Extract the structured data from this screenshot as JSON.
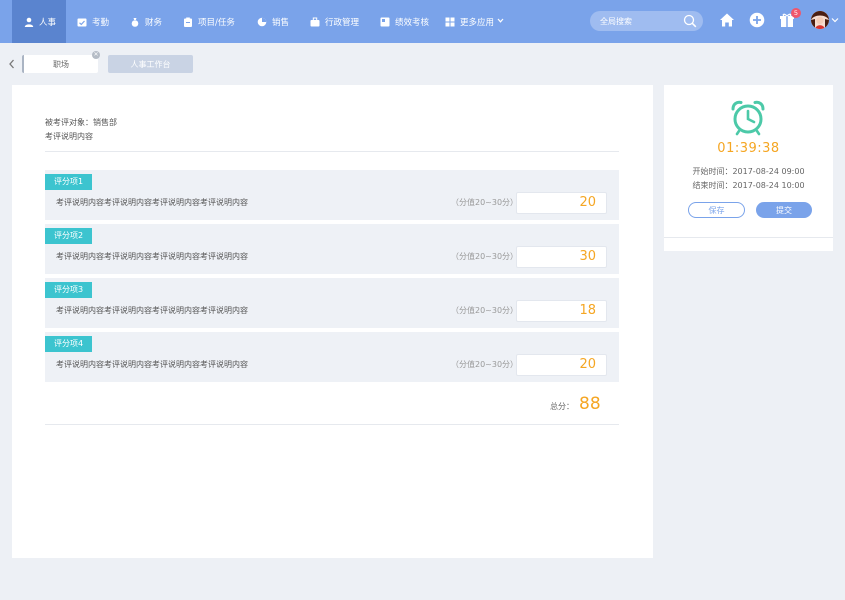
{
  "nav": {
    "items": [
      {
        "label": "人事",
        "icon": "person-icon"
      },
      {
        "label": "考勤",
        "icon": "calendar-check-icon"
      },
      {
        "label": "财务",
        "icon": "money-bag-icon"
      },
      {
        "label": "项目/任务",
        "icon": "clipboard-icon"
      },
      {
        "label": "销售",
        "icon": "pie-chart-icon"
      },
      {
        "label": "行政管理",
        "icon": "briefcase-icon"
      },
      {
        "label": "绩效考核",
        "icon": "report-icon"
      },
      {
        "label": "更多应用",
        "icon": "grid-icon"
      }
    ],
    "search_placeholder": "全局搜索",
    "notification_count": "5"
  },
  "tabs": {
    "active": "职场",
    "inactive": "人事工作台"
  },
  "review": {
    "target": "被考评对象：销售部",
    "description": "考评说明内容",
    "items": [
      {
        "tag": "评分项1",
        "desc": "考评说明内容考评说明内容考评说明内容考评说明内容",
        "range": "（分值20~30分）",
        "score": "20"
      },
      {
        "tag": "评分项2",
        "desc": "考评说明内容考评说明内容考评说明内容考评说明内容",
        "range": "（分值20~30分）",
        "score": "30"
      },
      {
        "tag": "评分项3",
        "desc": "考评说明内容考评说明内容考评说明内容考评说明内容",
        "range": "（分值20~30分）",
        "score": "18"
      },
      {
        "tag": "评分项4",
        "desc": "考评说明内容考评说明内容考评说明内容考评说明内容",
        "range": "（分值20~30分）",
        "score": "20"
      }
    ],
    "total_label": "总分：",
    "total_value": "88"
  },
  "timer": {
    "elapsed": "01:39:38",
    "start": "开始时间：2017-08-24 09:00",
    "end": "结束时间：2017-08-24 10:00",
    "save_label": "保存",
    "submit_label": "提交"
  },
  "colors": {
    "nav_bg": "#7aa3ea",
    "nav_active": "#5a84cf",
    "accent_orange": "#f5a623",
    "tag_teal": "#3cc4cf",
    "clock_green": "#4cc9a8"
  }
}
